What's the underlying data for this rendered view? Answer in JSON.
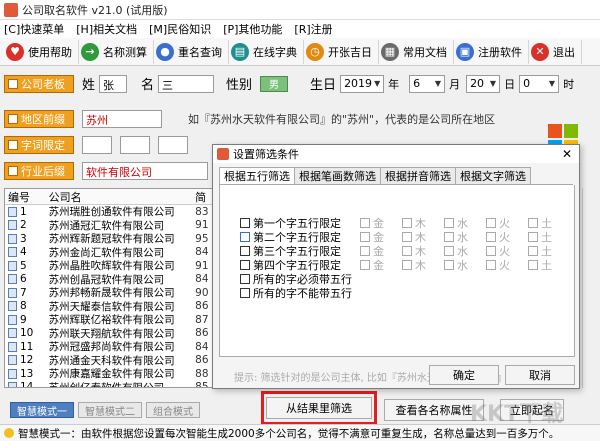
{
  "app": {
    "title": "公司取名软件 v21.0 (试用版)"
  },
  "menu": [
    "[C]快速菜单",
    "[H]相关文档",
    "[M]民俗知识",
    "[P]其他功能",
    "[R]注册"
  ],
  "toolbar": [
    {
      "label": "使用帮助",
      "icon": "heart-icon",
      "color": "#d9302a"
    },
    {
      "label": "名称测算",
      "icon": "arrow-right-icon",
      "color": "#2f9a3a"
    },
    {
      "label": "重名查询",
      "icon": "person-icon",
      "color": "#3a6fd0"
    },
    {
      "label": "在线字典",
      "icon": "book-icon",
      "color": "#1f8f8f"
    },
    {
      "label": "开张吉日",
      "icon": "calendar-icon",
      "color": "#e08a10"
    },
    {
      "label": "常用文档",
      "icon": "document-icon",
      "color": "#6a6a6a"
    },
    {
      "label": "注册软件",
      "icon": "register-icon",
      "color": "#3a6fd0"
    },
    {
      "label": "退出",
      "icon": "close-icon",
      "color": "#d9302a"
    }
  ],
  "form": {
    "boss_btn": "公司老板",
    "surname_label": "姓",
    "surname": "张",
    "name_label": "名",
    "given_name": "三",
    "gender_label": "性别",
    "gender": "男",
    "birth_label": "生日",
    "year": "2019",
    "year_unit": "年",
    "month": "6",
    "month_unit": "月",
    "day": "20",
    "day_unit": "日",
    "hour": "0",
    "hour_unit": "时",
    "region_btn": "地区前缀",
    "region": "苏州",
    "region_hint": "如『苏州水天软件有限公司』的\"苏州\"，代表的是公司所在地区",
    "char_btn": "字词限定",
    "industry_btn": "行业后缀",
    "industry": "软件有限公司"
  },
  "list": {
    "headers": [
      "编号",
      "公司名",
      "简"
    ],
    "rows": [
      {
        "no": "1",
        "name": "苏州瑞胜创通软件有限公司",
        "v": "83"
      },
      {
        "no": "2",
        "name": "苏州通冠汇软件有限公司",
        "v": "91"
      },
      {
        "no": "3",
        "name": "苏州辉新题冠软件有限公司",
        "v": "95"
      },
      {
        "no": "4",
        "name": "苏州金尚汇软件有限公司",
        "v": "84"
      },
      {
        "no": "5",
        "name": "苏州晶胜吹辉软件有限公司",
        "v": "91"
      },
      {
        "no": "6",
        "name": "苏州创晶冠软件有限公司",
        "v": "84"
      },
      {
        "no": "7",
        "name": "苏州邦畅新晟软件有限公司",
        "v": "90"
      },
      {
        "no": "8",
        "name": "苏州天耀泰信软件有限公司",
        "v": "86"
      },
      {
        "no": "9",
        "name": "苏州辉联亿裕软件有限公司",
        "v": "87"
      },
      {
        "no": "10",
        "name": "苏州联天翔航软件有限公司",
        "v": "86"
      },
      {
        "no": "11",
        "name": "苏州冠盛邦尚软件有限公司",
        "v": "84"
      },
      {
        "no": "12",
        "name": "苏州通金天科软件有限公司",
        "v": "86"
      },
      {
        "no": "13",
        "name": "苏州康嘉耀金软件有限公司",
        "v": "88"
      },
      {
        "no": "14",
        "name": "苏州创亿泰软件有限公司",
        "v": "85"
      }
    ]
  },
  "modes": [
    "智慧模式一",
    "智慧模式二",
    "组合模式"
  ],
  "status": "智慧模式一：由软件根据您设置每次智能生成2000多个公司名，觉得不满意可重复生成，名称总量达到一百多万个。",
  "bottom_buttons": {
    "filter": "从结果里筛选",
    "view": "查看各名称属性",
    "start": "立即起名"
  },
  "dialog": {
    "title": "设置筛选条件",
    "tabs": [
      "根据五行筛选",
      "根据笔画数筛选",
      "根据拼音筛选",
      "根据文字筛选"
    ],
    "rows": [
      "第一个字五行限定",
      "第二个字五行限定",
      "第三个字五行限定",
      "第四个字五行限定",
      "所有的字必须带五行",
      "所有的字不能带五行"
    ],
    "elements": [
      "金",
      "木",
      "水",
      "火",
      "土"
    ],
    "hint": "提示: 筛选针对的是公司主体, 比如『苏州水天软件有限公司』的『水天』",
    "ok": "确定",
    "cancel": "取消"
  },
  "watermark": "KKT下载"
}
